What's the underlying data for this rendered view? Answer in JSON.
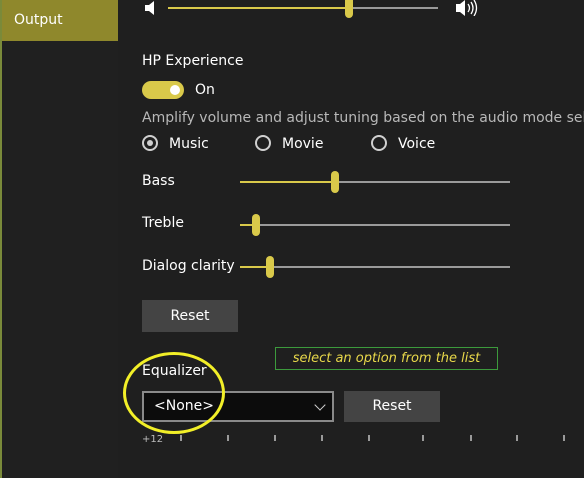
{
  "sidebar": {
    "output_label": "Output"
  },
  "volume": {
    "level": 0.67
  },
  "hp_experience": {
    "title": "HP Experience",
    "toggle_state": "On",
    "enabled": true
  },
  "description": "Amplify volume and adjust tuning based on the audio mode selected",
  "modes": [
    {
      "label": "Music",
      "selected": true
    },
    {
      "label": "Movie",
      "selected": false
    },
    {
      "label": "Voice",
      "selected": false
    }
  ],
  "sliders": [
    {
      "label": "Bass",
      "value": 0.35
    },
    {
      "label": "Treble",
      "value": 0.06
    },
    {
      "label": "Dialog clarity",
      "value": 0.11
    }
  ],
  "reset_label": "Reset",
  "hint": "select an option from the list",
  "equalizer": {
    "label": "Equalizer",
    "selected": "<None>",
    "reset_label": "Reset",
    "partial_axis_label": "+12"
  },
  "colors": {
    "accent": "#d9c94a",
    "sidebar_active": "#8f882c",
    "annotation": "#f2ef28",
    "hint_border": "#3c9a3c"
  }
}
